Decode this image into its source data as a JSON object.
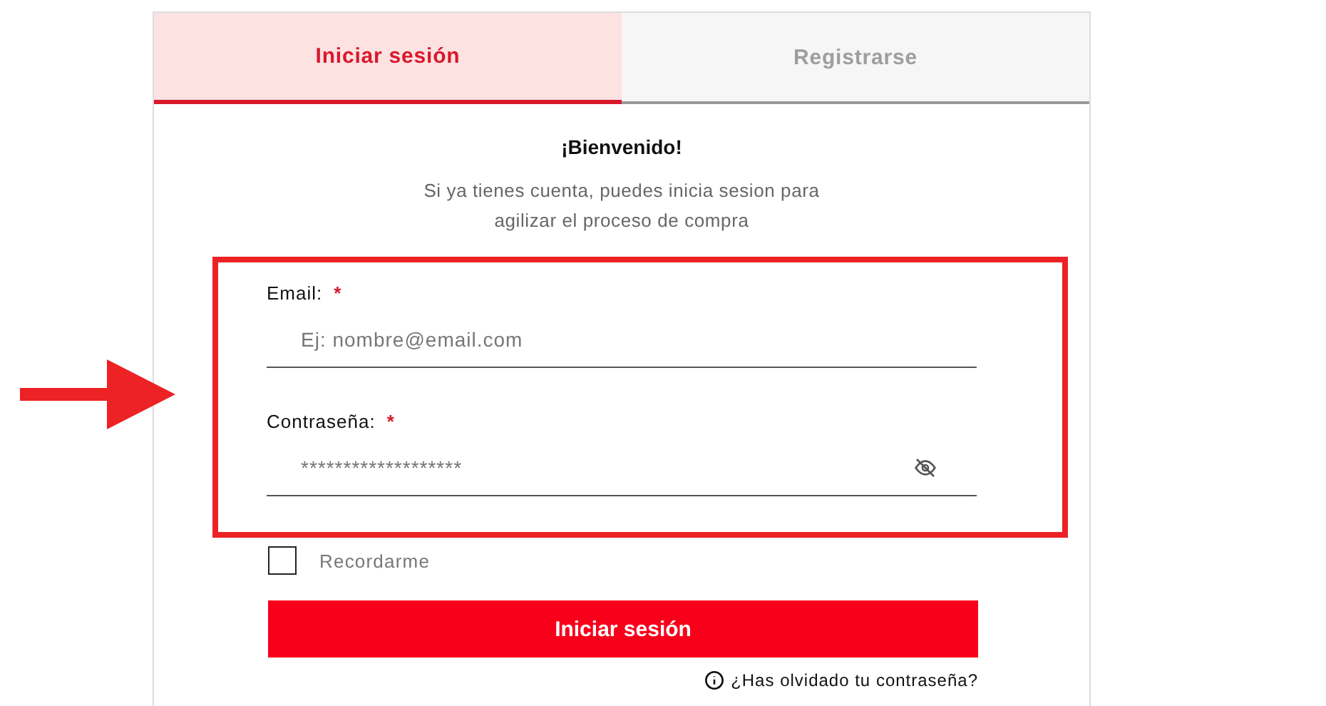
{
  "tabs": [
    {
      "label": "Iniciar sesión",
      "selected": true
    },
    {
      "label": "Registrarse",
      "selected": false
    }
  ],
  "welcome": {
    "title": "¡Bienvenido!",
    "lines": [
      "Si ya tienes cuenta, puedes inicia sesion para",
      "agilizar el proceso de compra"
    ]
  },
  "fields": [
    {
      "label": "Email:",
      "required_mark": "*",
      "placeholder": "Ej: nombre@email.com",
      "kind": "text"
    },
    {
      "label": "Contraseña:",
      "required_mark": "*",
      "value": "*******************",
      "kind": "password"
    }
  ],
  "remember": {
    "label": "Recordarme",
    "checked": false
  },
  "submit": "Iniciar sesión",
  "forgot": "¿Has olvidado tu contraseña?"
}
